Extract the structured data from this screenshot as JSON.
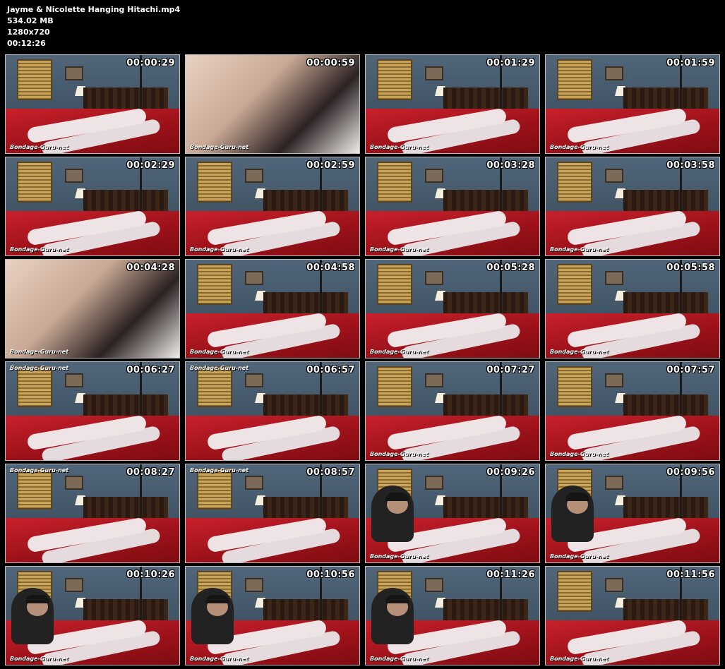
{
  "file_info": {
    "filename": "Jayme & Nicolette Hanging Hitachi.mp4",
    "size": "534.02 MB",
    "resolution": "1280x720",
    "duration": "00:12:26"
  },
  "watermark": "Bondage-Guru-net",
  "colors": {
    "background": "#000000",
    "thumb_border": "#bfbfbf",
    "timestamp": "#ffffff"
  },
  "thumbnails": [
    {
      "time": "00:00:29",
      "scene": "wide"
    },
    {
      "time": "00:00:59",
      "scene": "closeup"
    },
    {
      "time": "00:01:29",
      "scene": "wide"
    },
    {
      "time": "00:01:59",
      "scene": "wide"
    },
    {
      "time": "00:02:29",
      "scene": "wide"
    },
    {
      "time": "00:02:59",
      "scene": "wide"
    },
    {
      "time": "00:03:28",
      "scene": "wide"
    },
    {
      "time": "00:03:58",
      "scene": "wide"
    },
    {
      "time": "00:04:28",
      "scene": "closeup"
    },
    {
      "time": "00:04:58",
      "scene": "wide"
    },
    {
      "time": "00:05:28",
      "scene": "wide"
    },
    {
      "time": "00:05:58",
      "scene": "wide"
    },
    {
      "time": "00:06:27",
      "scene": "wide"
    },
    {
      "time": "00:06:57",
      "scene": "wide"
    },
    {
      "time": "00:07:27",
      "scene": "wide"
    },
    {
      "time": "00:07:57",
      "scene": "wide"
    },
    {
      "time": "00:08:27",
      "scene": "wide"
    },
    {
      "time": "00:08:57",
      "scene": "wide"
    },
    {
      "time": "00:09:26",
      "scene": "wide-man"
    },
    {
      "time": "00:09:56",
      "scene": "wide-man"
    },
    {
      "time": "00:10:26",
      "scene": "wide-man"
    },
    {
      "time": "00:10:56",
      "scene": "wide-man"
    },
    {
      "time": "00:11:26",
      "scene": "wide-man"
    },
    {
      "time": "00:11:56",
      "scene": "wide"
    }
  ]
}
